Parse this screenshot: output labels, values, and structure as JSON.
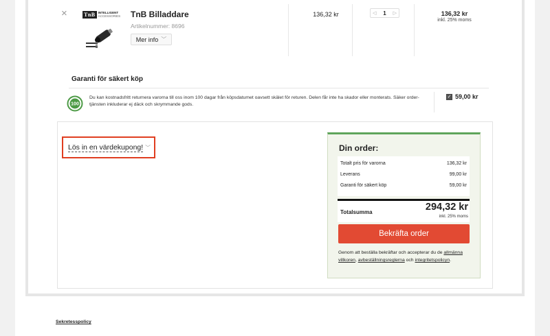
{
  "product": {
    "remove_icon": "close-icon",
    "brand_mark": "TnB",
    "brand_line1": "INTELLIGENT",
    "brand_line2": "ACCESSORIES",
    "name": "TnB Billaddare",
    "article": "Artikelnummer: 8696",
    "more_info": "Mer info",
    "unit_price": "136,32 kr",
    "quantity": "1",
    "total": "136,32 kr",
    "total_vat": "inkl. 25% moms"
  },
  "guarantee": {
    "title": "Garanti för säkert köp",
    "badge": "100",
    "text": "Du kan kostnadsfritt returnera varorna till oss inom 100 dagar från köpsdatumet oavsett skälet för returen. Delen får inte ha skador eller monterats. Säker order-tjänsten inkluderar ej däck och skrymmande gods.",
    "checked": true,
    "price": "59,00 kr"
  },
  "coupon": {
    "label": "Lös in en värdekupong!"
  },
  "order": {
    "title": "Din order:",
    "lines": [
      {
        "label": "Totalt pris för varorna",
        "value": "136,32 kr"
      },
      {
        "label": "Leverans",
        "value": "99,00 kr"
      },
      {
        "label": "Garanti för säkert köp",
        "value": "59,00 kr"
      }
    ],
    "total_label": "Totalsumma",
    "total_value": "294,32 kr",
    "total_vat": "inkl. 25% moms",
    "confirm_label": "Bekräfta order",
    "terms_prefix": "Genom att beställa bekräftar och accepterar du de",
    "terms_link1": "allmänna villkoren",
    "terms_sep": ",",
    "terms_link2": "avbeställningsreglerna",
    "terms_and": "och",
    "terms_link3": "integritetspolicyn",
    "terms_end": "."
  },
  "footer": {
    "privacy": "Sekretesspolicy"
  },
  "colors": {
    "accent_red": "#e24a33",
    "coupon_highlight": "#e03d1f",
    "order_green": "#5ea45a"
  }
}
